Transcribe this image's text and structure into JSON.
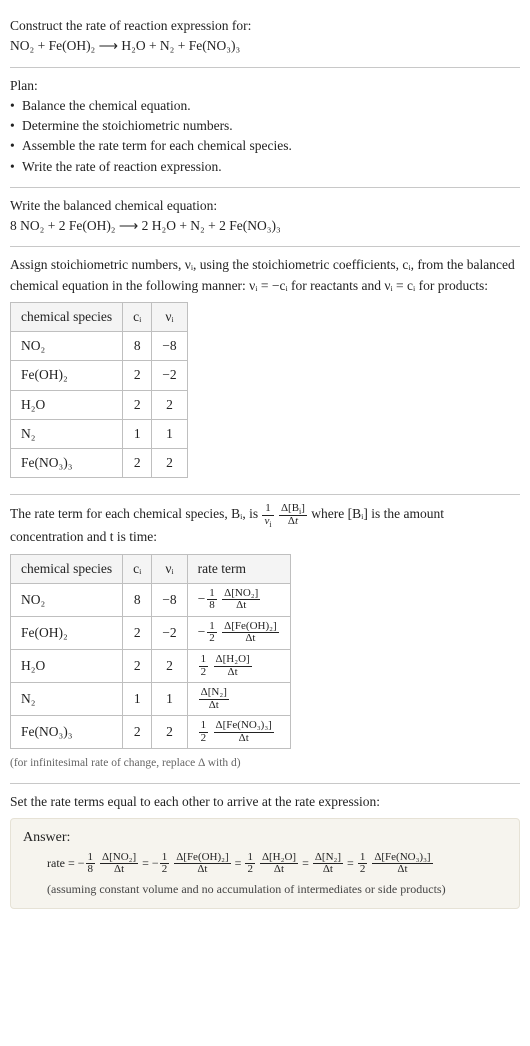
{
  "intro": {
    "prompt": "Construct the rate of reaction expression for:",
    "equation": "NO₂ + Fe(OH)₂ ⟶ H₂O + N₂ + Fe(NO₃)₃"
  },
  "plan": {
    "heading": "Plan:",
    "items": [
      "Balance the chemical equation.",
      "Determine the stoichiometric numbers.",
      "Assemble the rate term for each chemical species.",
      "Write the rate of reaction expression."
    ]
  },
  "balanced": {
    "heading": "Write the balanced chemical equation:",
    "equation": "8 NO₂ + 2 Fe(OH)₂ ⟶ 2 H₂O + N₂ + 2 Fe(NO₃)₃"
  },
  "stoich": {
    "intro": "Assign stoichiometric numbers, νᵢ, using the stoichiometric coefficients, cᵢ, from the balanced chemical equation in the following manner: νᵢ = −cᵢ for reactants and νᵢ = cᵢ for products:",
    "headers": [
      "chemical species",
      "cᵢ",
      "νᵢ"
    ],
    "rows": [
      {
        "species": "NO₂",
        "ci": "8",
        "nu": "−8"
      },
      {
        "species": "Fe(OH)₂",
        "ci": "2",
        "nu": "−2"
      },
      {
        "species": "H₂O",
        "ci": "2",
        "nu": "2"
      },
      {
        "species": "N₂",
        "ci": "1",
        "nu": "1"
      },
      {
        "species": "Fe(NO₃)₃",
        "ci": "2",
        "nu": "2"
      }
    ]
  },
  "rate_terms": {
    "intro_pre": "The rate term for each chemical species, Bᵢ, is ",
    "intro_post": " where [Bᵢ] is the amount concentration and t is time:",
    "headers": [
      "chemical species",
      "cᵢ",
      "νᵢ",
      "rate term"
    ],
    "rows": [
      {
        "species": "NO₂",
        "ci": "8",
        "nu": "−8",
        "term_neg": true,
        "term_coef_num": "1",
        "term_coef_den": "8",
        "term_num": "Δ[NO₂]",
        "term_den": "Δt"
      },
      {
        "species": "Fe(OH)₂",
        "ci": "2",
        "nu": "−2",
        "term_neg": true,
        "term_coef_num": "1",
        "term_coef_den": "2",
        "term_num": "Δ[Fe(OH)₂]",
        "term_den": "Δt"
      },
      {
        "species": "H₂O",
        "ci": "2",
        "nu": "2",
        "term_neg": false,
        "term_coef_num": "1",
        "term_coef_den": "2",
        "term_num": "Δ[H₂O]",
        "term_den": "Δt"
      },
      {
        "species": "N₂",
        "ci": "1",
        "nu": "1",
        "term_neg": false,
        "term_coef_num": "",
        "term_coef_den": "",
        "term_num": "Δ[N₂]",
        "term_den": "Δt"
      },
      {
        "species": "Fe(NO₃)₃",
        "ci": "2",
        "nu": "2",
        "term_neg": false,
        "term_coef_num": "1",
        "term_coef_den": "2",
        "term_num": "Δ[Fe(NO₃)₃]",
        "term_den": "Δt"
      }
    ],
    "hint": "(for infinitesimal rate of change, replace Δ with d)"
  },
  "final": {
    "heading": "Set the rate terms equal to each other to arrive at the rate expression:",
    "answer_label": "Answer:",
    "prefix": "rate = ",
    "terms": [
      {
        "neg": true,
        "coef_num": "1",
        "coef_den": "8",
        "num": "Δ[NO₂]",
        "den": "Δt"
      },
      {
        "neg": true,
        "coef_num": "1",
        "coef_den": "2",
        "num": "Δ[Fe(OH)₂]",
        "den": "Δt"
      },
      {
        "neg": false,
        "coef_num": "1",
        "coef_den": "2",
        "num": "Δ[H₂O]",
        "den": "Δt"
      },
      {
        "neg": false,
        "coef_num": "",
        "coef_den": "",
        "num": "Δ[N₂]",
        "den": "Δt"
      },
      {
        "neg": false,
        "coef_num": "1",
        "coef_den": "2",
        "num": "Δ[Fe(NO₃)₃]",
        "den": "Δt"
      }
    ],
    "eq": " = ",
    "note": "(assuming constant volume and no accumulation of intermediates or side products)"
  },
  "chart_data": {
    "type": "table",
    "title": "Stoichiometric numbers and rate terms",
    "tables": [
      {
        "columns": [
          "chemical species",
          "c_i",
          "nu_i"
        ],
        "rows": [
          [
            "NO2",
            8,
            -8
          ],
          [
            "Fe(OH)2",
            2,
            -2
          ],
          [
            "H2O",
            2,
            2
          ],
          [
            "N2",
            1,
            1
          ],
          [
            "Fe(NO3)3",
            2,
            2
          ]
        ]
      },
      {
        "columns": [
          "chemical species",
          "c_i",
          "nu_i",
          "rate term"
        ],
        "rows": [
          [
            "NO2",
            8,
            -8,
            "-(1/8) d[NO2]/dt"
          ],
          [
            "Fe(OH)2",
            2,
            -2,
            "-(1/2) d[Fe(OH)2]/dt"
          ],
          [
            "H2O",
            2,
            2,
            "(1/2) d[H2O]/dt"
          ],
          [
            "N2",
            1,
            1,
            "d[N2]/dt"
          ],
          [
            "Fe(NO3)3",
            2,
            2,
            "(1/2) d[Fe(NO3)3]/dt"
          ]
        ]
      }
    ],
    "rate_expression": "rate = -(1/8) d[NO2]/dt = -(1/2) d[Fe(OH)2]/dt = (1/2) d[H2O]/dt = d[N2]/dt = (1/2) d[Fe(NO3)3]/dt"
  }
}
